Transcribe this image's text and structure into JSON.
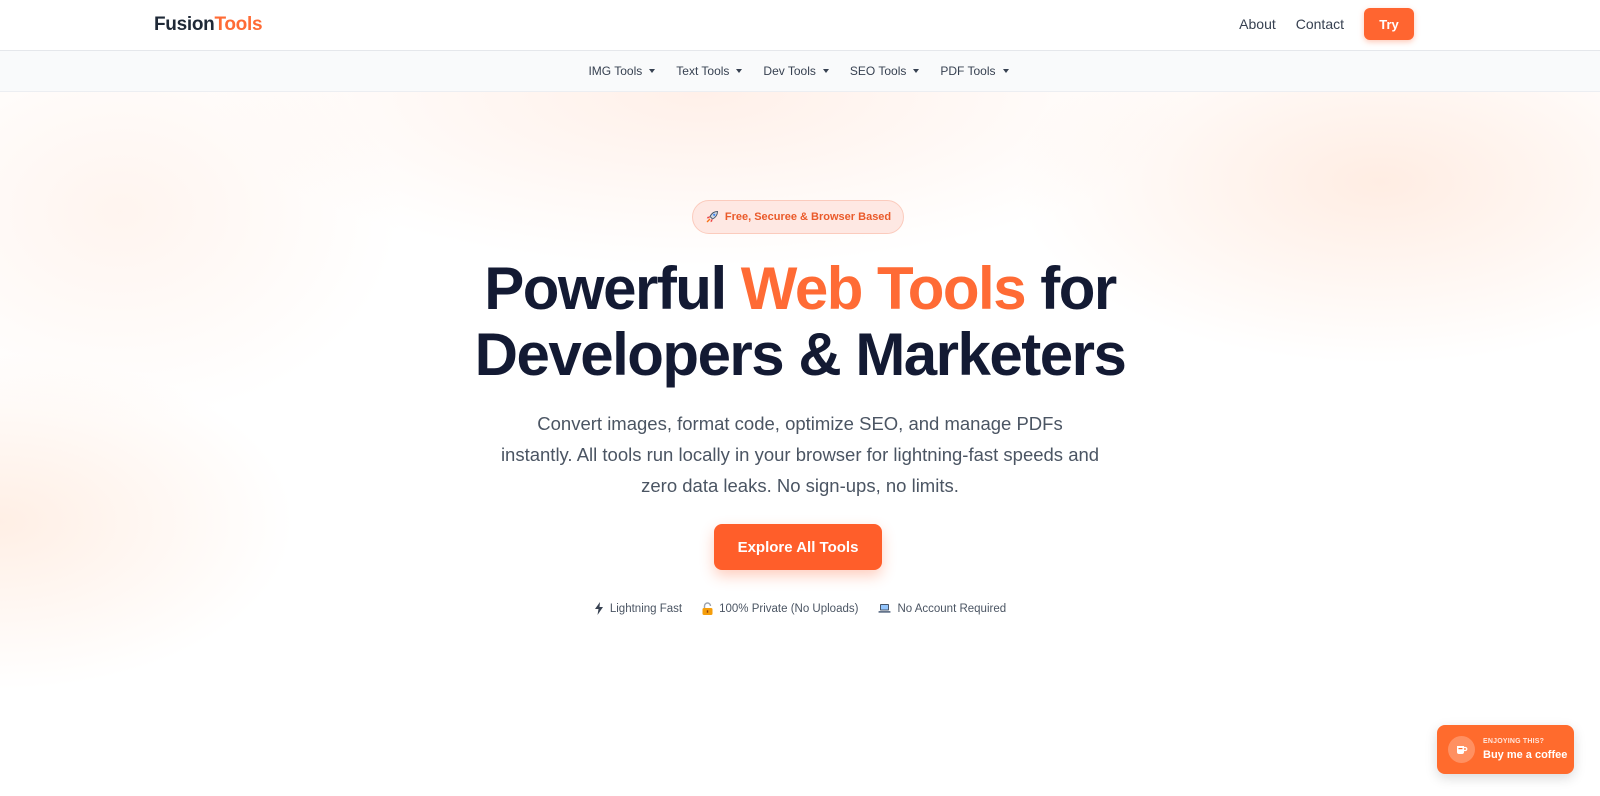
{
  "header": {
    "logo_part1": "Fusion",
    "logo_part2": "Tools",
    "nav": [
      "About",
      "Contact"
    ],
    "try_label": "Try"
  },
  "subnav": {
    "items": [
      "IMG Tools",
      "Text Tools",
      "Dev Tools",
      "SEO Tools",
      "PDF Tools"
    ]
  },
  "hero": {
    "badge_icon": "rocket-icon",
    "badge": "Free, Securee & Browser Based",
    "headline_part1": "Powerful ",
    "headline_accent": "Web Tools",
    "headline_part2": " for",
    "headline_line2": "Developers & Marketers",
    "subtitle": "Convert images, format code, optimize SEO, and manage PDFs instantly. All tools run locally in your browser for lightning-fast speeds and zero data leaks. No sign-ups, no limits.",
    "cta": "Explore All Tools",
    "features": [
      {
        "icon": "lightning-icon",
        "label": "Lightning Fast"
      },
      {
        "icon": "lock-icon",
        "label": "100% Private (No Uploads)"
      },
      {
        "icon": "laptop-icon",
        "label": "No Account Required"
      }
    ]
  },
  "coffee": {
    "icon": "coffee-cup-icon",
    "kicker": "ENJOYING THIS?",
    "label": "Buy me a coffee"
  },
  "colors": {
    "accent": "#ff6b35",
    "heading": "#131a33",
    "text": "#4b5563"
  }
}
